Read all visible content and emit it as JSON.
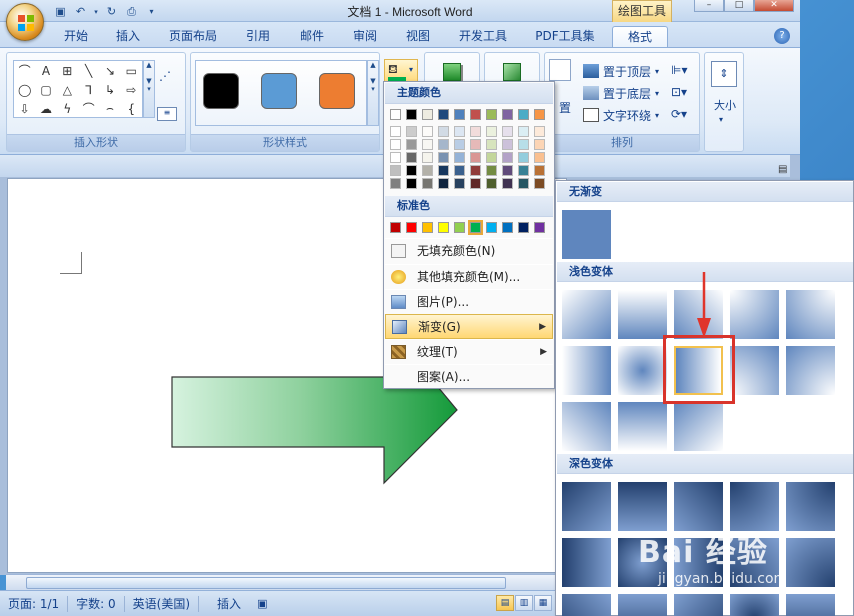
{
  "window": {
    "title": "文档 1 - Microsoft Word",
    "context_tab": "绘图工具"
  },
  "ribbon": {
    "tabs": [
      "开始",
      "插入",
      "页面布局",
      "引用",
      "邮件",
      "审阅",
      "视图",
      "开发工具",
      "PDF工具集",
      "格式"
    ],
    "active_tab": "格式",
    "groups": {
      "insert_shapes": "插入形状",
      "shape_styles": "形状样式",
      "arrange": "排列"
    },
    "arrange": {
      "bring_front": "置于顶层",
      "send_back": "置于底层",
      "text_wrap": "文字环绕",
      "position_partial": "置"
    },
    "size_label": "大小",
    "style_swatches": [
      "#000000",
      "#5b9bd5",
      "#ed7d31"
    ]
  },
  "color_menu": {
    "theme_colors_header": "主题颜色",
    "standard_colors_header": "标准色",
    "theme_colors": [
      "#ffffff",
      "#000000",
      "#eeece1",
      "#1f497d",
      "#4f81bd",
      "#c0504d",
      "#9bbb59",
      "#8064a2",
      "#4bacc6",
      "#f79646"
    ],
    "standard_colors": [
      "#c00000",
      "#ff0000",
      "#ffc000",
      "#ffff00",
      "#92d050",
      "#00b050",
      "#00b0f0",
      "#0070c0",
      "#002060",
      "#7030a0"
    ],
    "items": {
      "no_fill": "无填充颜色(N)",
      "more_colors": "其他填充颜色(M)...",
      "picture": "图片(P)...",
      "gradient": "渐变(G)",
      "texture": "纹理(T)",
      "pattern": "图案(A)..."
    }
  },
  "gradient_menu": {
    "no_gradient": "无渐变",
    "light_variations": "浅色变体",
    "dark_variations": "深色变体"
  },
  "status": {
    "page": "页面: 1/1",
    "words": "字数: 0",
    "language": "英语(美国)",
    "mode": "插入"
  },
  "watermark": {
    "brand": "Bai 经验",
    "url": "jingyan.baidu.com"
  }
}
